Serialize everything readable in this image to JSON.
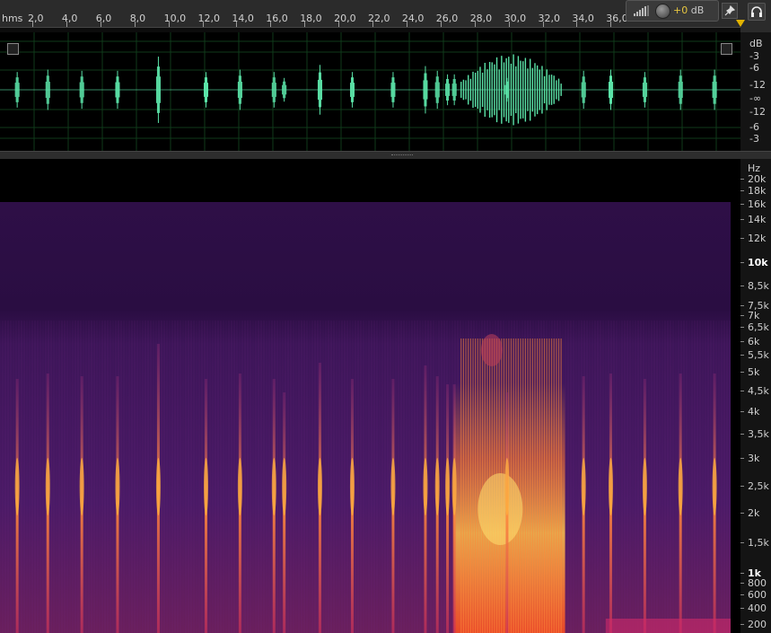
{
  "ruler": {
    "unit": "hms",
    "ticks": [
      "2,0",
      "4,0",
      "6,0",
      "8,0",
      "10,0",
      "12,0",
      "14,0",
      "16,0",
      "18,0",
      "20,0",
      "22,0",
      "24,0",
      "26,0",
      "28,0",
      "30,0",
      "32,0",
      "34,0",
      "36,0"
    ]
  },
  "toolbar": {
    "gain_value": "+0",
    "gain_unit": "dB",
    "pin_icon": "pin-icon",
    "headphones_icon": "headphones-icon",
    "meter_icon": "signal-bars-icon",
    "knob_icon": "volume-knob-icon"
  },
  "waveform": {
    "scale_labels": [
      "dB",
      "-3",
      "-6",
      "-12",
      "-∞",
      "-12",
      "-6",
      "-3"
    ],
    "color": "#5be3a8",
    "bursts": [
      {
        "t": 0.9,
        "amp": 0.15
      },
      {
        "t": 2.7,
        "amp": 0.17
      },
      {
        "t": 4.7,
        "amp": 0.16
      },
      {
        "t": 6.8,
        "amp": 0.16
      },
      {
        "t": 9.2,
        "amp": 0.28
      },
      {
        "t": 12.0,
        "amp": 0.15
      },
      {
        "t": 14.0,
        "amp": 0.17
      },
      {
        "t": 16.0,
        "amp": 0.15
      },
      {
        "t": 16.6,
        "amp": 0.1
      },
      {
        "t": 18.7,
        "amp": 0.21
      },
      {
        "t": 20.6,
        "amp": 0.15
      },
      {
        "t": 23.0,
        "amp": 0.15
      },
      {
        "t": 24.9,
        "amp": 0.2
      },
      {
        "t": 25.6,
        "amp": 0.16
      },
      {
        "t": 26.2,
        "amp": 0.13
      },
      {
        "t": 26.6,
        "amp": 0.13
      },
      {
        "t": 29.7,
        "amp": 0.1
      },
      {
        "t": 34.2,
        "amp": 0.16
      },
      {
        "t": 35.8,
        "amp": 0.17
      },
      {
        "t": 37.8,
        "amp": 0.15
      },
      {
        "t": 39.9,
        "amp": 0.17
      },
      {
        "t": 41.9,
        "amp": 0.17
      }
    ],
    "dense_section": {
      "start": 27.0,
      "end": 32.9,
      "peak": 0.3
    }
  },
  "spectral": {
    "unit_label": "Hz",
    "freq_labels": [
      {
        "label": "20k",
        "hz": 20000
      },
      {
        "label": "18k",
        "hz": 18000
      },
      {
        "label": "16k",
        "hz": 16000
      },
      {
        "label": "14k",
        "hz": 14000
      },
      {
        "label": "12k",
        "hz": 12000
      },
      {
        "label": "10k",
        "hz": 10000,
        "bold": true
      },
      {
        "label": "8,5k",
        "hz": 8500
      },
      {
        "label": "7,5k",
        "hz": 7500
      },
      {
        "label": "7k",
        "hz": 7000
      },
      {
        "label": "6,5k",
        "hz": 6500
      },
      {
        "label": "6k",
        "hz": 6000
      },
      {
        "label": "5,5k",
        "hz": 5500
      },
      {
        "label": "5k",
        "hz": 5000
      },
      {
        "label": "4,5k",
        "hz": 4500
      },
      {
        "label": "4k",
        "hz": 4000
      },
      {
        "label": "3,5k",
        "hz": 3500
      },
      {
        "label": "3k",
        "hz": 3000
      },
      {
        "label": "2,5k",
        "hz": 2500
      },
      {
        "label": "2k",
        "hz": 2000
      },
      {
        "label": "1,5k",
        "hz": 1500
      },
      {
        "label": "1k",
        "hz": 1000,
        "bold": true
      },
      {
        "label": "800",
        "hz": 800
      },
      {
        "label": "600",
        "hz": 600
      },
      {
        "label": "400",
        "hz": 400
      },
      {
        "label": "200",
        "hz": 200
      }
    ],
    "colors": {
      "bg": "#2a0d3d",
      "upper": "#250b3a",
      "mid": "#3d1560",
      "hot": "#ff5a1f",
      "peak": "#ffd25a"
    }
  }
}
